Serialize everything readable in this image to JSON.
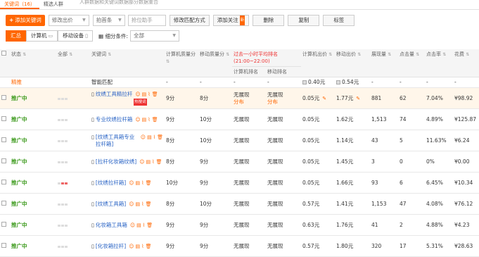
{
  "tabs": [
    {
      "label": "关键词（16）"
    },
    {
      "label": "精选人群"
    }
  ],
  "tab_note": "人群数据和关键词数据部分数据重合",
  "toolbar": {
    "add_keyword": "添加关键词",
    "bid_select": "修改出价",
    "match_select": "拍首条",
    "rank_input_placeholder": "抢位助手",
    "match_mode": "修改匹配方式",
    "add_follow": "添加关注",
    "new_badge": "新",
    "delete": "删除",
    "copy": "复制",
    "tag": "标签"
  },
  "filterbar": {
    "summary": "汇总",
    "computer": "计算机",
    "mobile": "移动设备",
    "filter_label": "细分条件:",
    "filter_value": "全部"
  },
  "columns": {
    "status": "状态",
    "all": "全部",
    "keyword": "关键词",
    "pc_quality": "计算机质量分",
    "mobile_quality": "移动质量分",
    "rank_header": "过去一小时平均排名(21:00~22:00)",
    "pc_rank": "计算机排名",
    "mobile_rank": "移动排名",
    "pc_bid": "计算机出价",
    "mobile_bid": "移动出价",
    "impressions": "展现量",
    "clicks": "点击量",
    "ctr": "点击率",
    "cost": "花费"
  },
  "subrow": {
    "status": "精推",
    "keyword": "智能匹配",
    "pc_quality": "-",
    "mobile_quality": "-",
    "pc_rank": "-",
    "mobile_rank": "-",
    "pc_bid": "0.40元",
    "mobile_bid": "0.54元",
    "impressions": "-",
    "clicks": "-",
    "ctr": "-",
    "cost": "-"
  },
  "row_badge": "热搜词",
  "rows": [
    {
      "status": "推广中",
      "keyword": "纹绣工具精拉杆",
      "pc_quality": "9分",
      "mobile_quality": "8分",
      "pc_rank": "无展现分布",
      "mobile_rank": "无展现分布",
      "pc_bid": "0.05元",
      "mobile_bid": "1.77元",
      "impressions": "881",
      "clicks": "62",
      "ctr": "7.04%",
      "cost": "¥98.92"
    },
    {
      "status": "推广中",
      "keyword": "专业纹绣拉杆箱",
      "pc_quality": "9分",
      "mobile_quality": "10分",
      "pc_rank": "无展现",
      "mobile_rank": "无展现",
      "pc_bid": "0.05元",
      "mobile_bid": "1.62元",
      "impressions": "1,513",
      "clicks": "74",
      "ctr": "4.89%",
      "cost": "¥125.87"
    },
    {
      "status": "推广中",
      "keyword": "[纹绣工具箱专业拉杆箱]",
      "pc_quality": "8分",
      "mobile_quality": "10分",
      "pc_rank": "无展现",
      "mobile_rank": "无展现",
      "pc_bid": "0.05元",
      "mobile_bid": "1.14元",
      "impressions": "43",
      "clicks": "5",
      "ctr": "11.63%",
      "cost": "¥6.24"
    },
    {
      "status": "推广中",
      "keyword": "[拉杆化妆箱纹绣]",
      "pc_quality": "8分",
      "mobile_quality": "9分",
      "pc_rank": "无展现",
      "mobile_rank": "无展现",
      "pc_bid": "0.05元",
      "mobile_bid": "1.45元",
      "impressions": "3",
      "clicks": "0",
      "ctr": "0%",
      "cost": "¥0.00"
    },
    {
      "status": "推广中",
      "keyword": "[纹绣拉杆箱]",
      "pc_quality": "10分",
      "mobile_quality": "9分",
      "pc_rank": "无展现",
      "mobile_rank": "无展现",
      "pc_bid": "0.05元",
      "mobile_bid": "1.66元",
      "impressions": "93",
      "clicks": "6",
      "ctr": "6.45%",
      "cost": "¥10.34"
    },
    {
      "status": "推广中",
      "keyword": "[纹绣工具箱]",
      "pc_quality": "8分",
      "mobile_quality": "10分",
      "pc_rank": "无展现",
      "mobile_rank": "无展现",
      "pc_bid": "0.57元",
      "mobile_bid": "1.41元",
      "impressions": "1,153",
      "clicks": "47",
      "ctr": "4.08%",
      "cost": "¥76.12"
    },
    {
      "status": "推广中",
      "keyword": "化妆箱工具箱",
      "pc_quality": "9分",
      "mobile_quality": "9分",
      "pc_rank": "无展现",
      "mobile_rank": "无展现",
      "pc_bid": "0.63元",
      "mobile_bid": "1.76元",
      "impressions": "41",
      "clicks": "2",
      "ctr": "4.88%",
      "cost": "¥4.23"
    },
    {
      "status": "推广中",
      "keyword": "[化妆箱拉杆]",
      "pc_quality": "9分",
      "mobile_quality": "9分",
      "pc_rank": "无展现",
      "mobile_rank": "无展现",
      "pc_bid": "0.57元",
      "mobile_bid": "1.80元",
      "impressions": "320",
      "clicks": "17",
      "ctr": "5.31%",
      "cost": "¥28.63"
    }
  ]
}
